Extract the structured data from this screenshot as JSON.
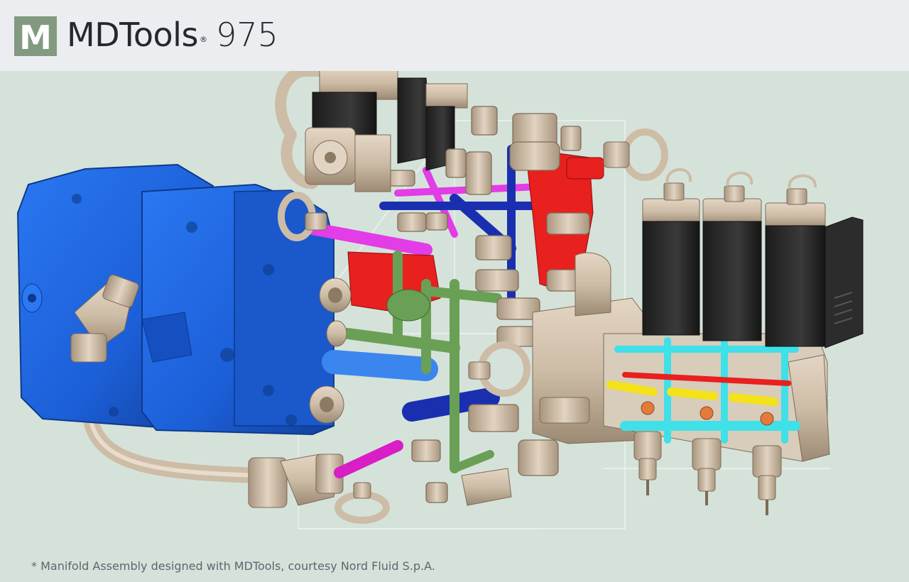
{
  "header": {
    "logo_letter": "M",
    "brand_name": "MDTools",
    "registered_mark": "®",
    "version": "975"
  },
  "image": {
    "alt": "3D CAD render of a hydraulic manifold assembly with blue pump motor, solenoid valves and colored internal channels"
  },
  "caption": "* Manifold Assembly designed with MDTools, courtesy Nord Fluid S.p.A.",
  "colors": {
    "header_bg": "#ebedf0",
    "page_bg": "#d5e2da",
    "logo_green": "#829a80",
    "motor_blue": "#1e66e6",
    "metal_tan": "#cdbca6",
    "solenoid_black": "#2a2a2a",
    "channel_red": "#e8201e",
    "channel_magenta": "#e23de6",
    "channel_green": "#6aa055",
    "channel_cyan": "#3fe0e8",
    "channel_yellow": "#f4e21a",
    "channel_navy": "#1a2fb0"
  }
}
